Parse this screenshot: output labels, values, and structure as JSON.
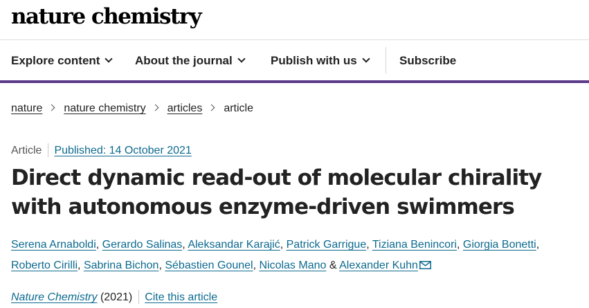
{
  "header": {
    "logo_text": "nature chemistry"
  },
  "nav": {
    "items": [
      {
        "label": "Explore content"
      },
      {
        "label": "About the journal"
      },
      {
        "label": "Publish with us"
      }
    ],
    "subscribe_label": "Subscribe"
  },
  "breadcrumb": {
    "items": [
      "nature",
      "nature chemistry",
      "articles"
    ],
    "current": "article"
  },
  "article": {
    "type": "Article",
    "published": "Published: 14 October 2021",
    "title": "Direct dynamic read-out of molecular chirality with autonomous enzyme-driven swimmers",
    "authors": [
      "Serena Arnaboldi",
      "Gerardo Salinas",
      "Aleksandar Karajić",
      "Patrick Garrigue",
      "Tiziana Benincori",
      "Giorgia Bonetti",
      "Roberto Cirilli",
      "Sabrina Bichon",
      "Sébastien Gounel",
      "Nicolas Mano",
      "Alexander Kuhn"
    ],
    "separator": ",",
    "conjunction": "&",
    "journal": "Nature Chemistry",
    "year": "(2021)",
    "cite_label": "Cite this article"
  },
  "colors": {
    "accent": "#5b3a8a",
    "link": "#0c6a8f"
  },
  "icons": {
    "nav_dropdown": "chevron-down-icon",
    "breadcrumb_separator": "chevron-right-icon",
    "corresponding_author": "mail-icon"
  }
}
